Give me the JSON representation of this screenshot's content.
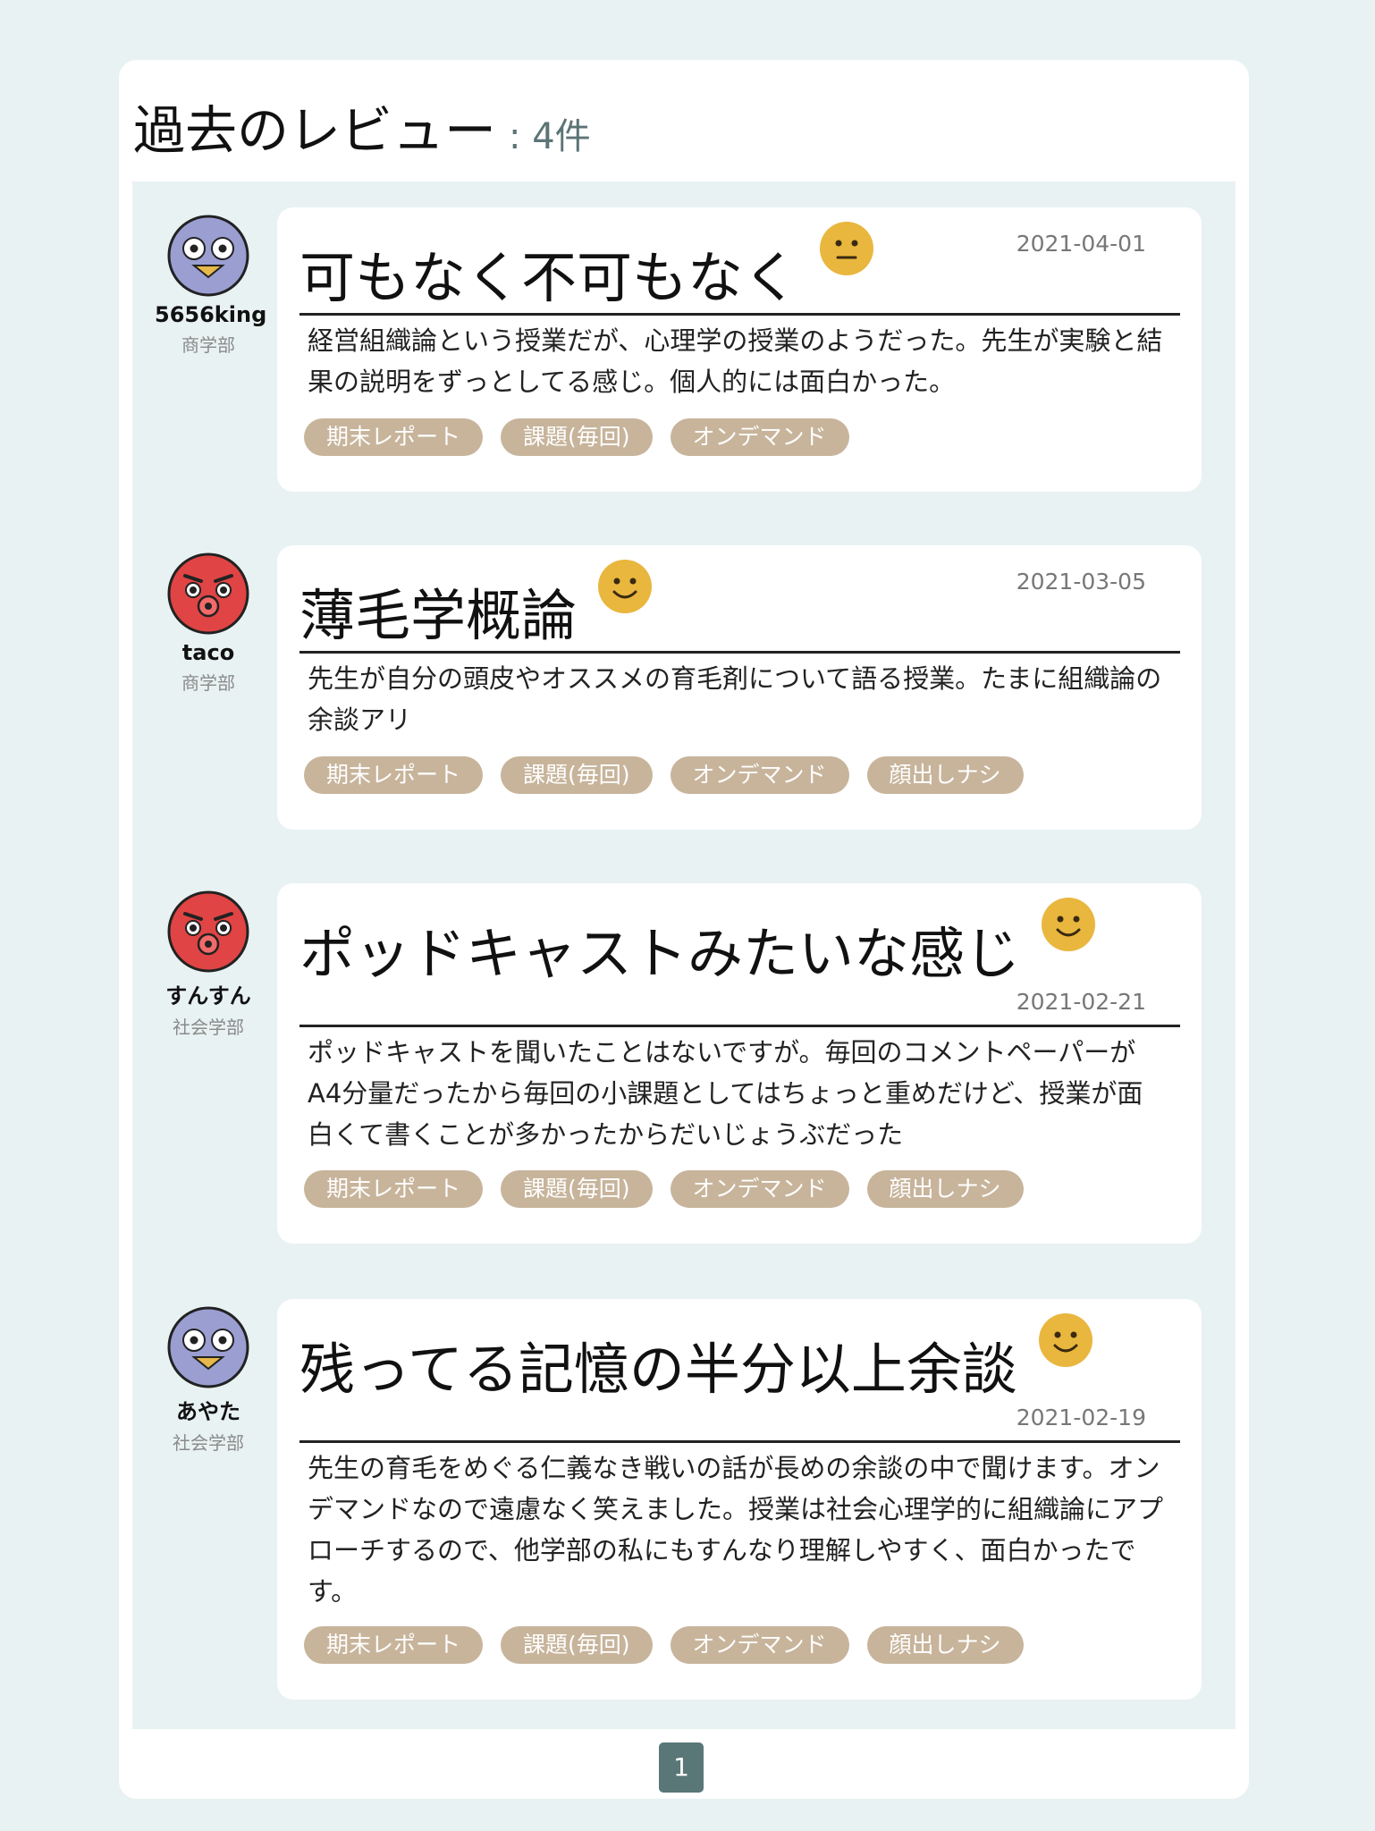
{
  "header": {
    "title": "過去のレビュー",
    "count": ": 4件"
  },
  "reviews": [
    {
      "author": "5656king",
      "faculty": "商学部",
      "avatar_icon": "penguin-icon",
      "title": "可もなく不可もなく",
      "mood_icon": "neutral-face-icon",
      "date": "2021-04-01",
      "comment": "経営組織論という授業だが、心理学の授業のようだった。先生が実験と結果の説明をずっとしてる感じ。個人的には面白かった。",
      "tags": [
        "期末レポート",
        "課題(毎回)",
        "オンデマンド"
      ]
    },
    {
      "author": "taco",
      "faculty": "商学部",
      "avatar_icon": "angry-octopus-icon",
      "title": "薄毛学概論",
      "mood_icon": "smiling-face-icon",
      "date": "2021-03-05",
      "comment": "先生が自分の頭皮やオススメの育毛剤について語る授業。たまに組織論の余談アリ",
      "tags": [
        "期末レポート",
        "課題(毎回)",
        "オンデマンド",
        "顔出しナシ"
      ]
    },
    {
      "author": "すんすん",
      "faculty": "社会学部",
      "avatar_icon": "angry-octopus-icon",
      "title": "ポッドキャストみたいな感じ",
      "mood_icon": "smiling-face-icon",
      "date": "2021-02-21",
      "comment": "ポッドキャストを聞いたことはないですが。毎回のコメントペーパーがA4分量だったから毎回の小課題としてはちょっと重めだけど、授業が面白くて書くことが多かったからだいじょうぶだった",
      "tags": [
        "期末レポート",
        "課題(毎回)",
        "オンデマンド",
        "顔出しナシ"
      ]
    },
    {
      "author": "あやた",
      "faculty": "社会学部",
      "avatar_icon": "penguin-icon",
      "title": "残ってる記憶の半分以上余談",
      "mood_icon": "smiling-face-icon",
      "date": "2021-02-19",
      "comment": "先生の育毛をめぐる仁義なき戦いの話が長めの余談の中で聞けます。オンデマンドなので遠慮なく笑えました。授業は社会心理学的に組織論にアプローチするので、他学部の私にもすんなり理解しやすく、面白かったです。",
      "tags": [
        "期末レポート",
        "課題(毎回)",
        "オンデマンド",
        "顔出しナシ"
      ]
    }
  ],
  "pagination": {
    "current": "1"
  },
  "colors": {
    "background": "#e8f2f2",
    "tag": "#c7b49b",
    "pager": "#5a7778",
    "mood": "#e9b63e"
  }
}
